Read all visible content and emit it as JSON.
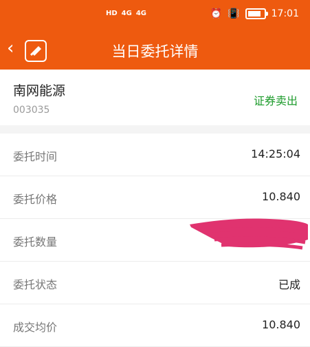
{
  "status_bar": {
    "network": [
      "HD",
      "4G",
      "4G"
    ],
    "time": "17:01",
    "icons": [
      "alarm-icon",
      "vibrate-icon",
      "battery-icon"
    ]
  },
  "header": {
    "title": "当日委托详情"
  },
  "stock": {
    "name": "南网能源",
    "code": "003035",
    "action": "证券卖出"
  },
  "details": [
    {
      "label": "委托时间",
      "value": "14:25:04"
    },
    {
      "label": "委托价格",
      "value": "10.840"
    },
    {
      "label": "委托数量",
      "value": ""
    },
    {
      "label": "委托状态",
      "value": "已成"
    },
    {
      "label": "成交均价",
      "value": "10.840"
    }
  ],
  "colors": {
    "brand": "#ee5a0f",
    "sell": "#1c9b2b",
    "redaction": "#e0336f"
  }
}
